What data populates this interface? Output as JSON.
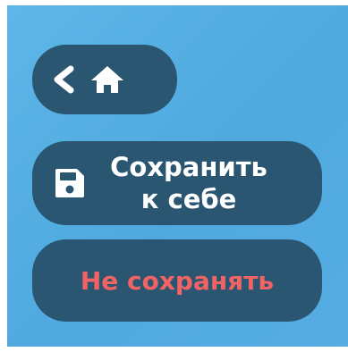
{
  "back_button": {
    "icons": [
      "chevron-left-icon",
      "home-icon"
    ]
  },
  "save_button": {
    "icon": "floppy-disk-icon",
    "label_line1": "Сохранить",
    "label_line2": "к себе"
  },
  "dont_save_button": {
    "label": "Не сохранять"
  },
  "colors": {
    "background": "#55ade2",
    "button": "#2a5672",
    "text": "#ffffff",
    "danger_text": "#f26464"
  }
}
